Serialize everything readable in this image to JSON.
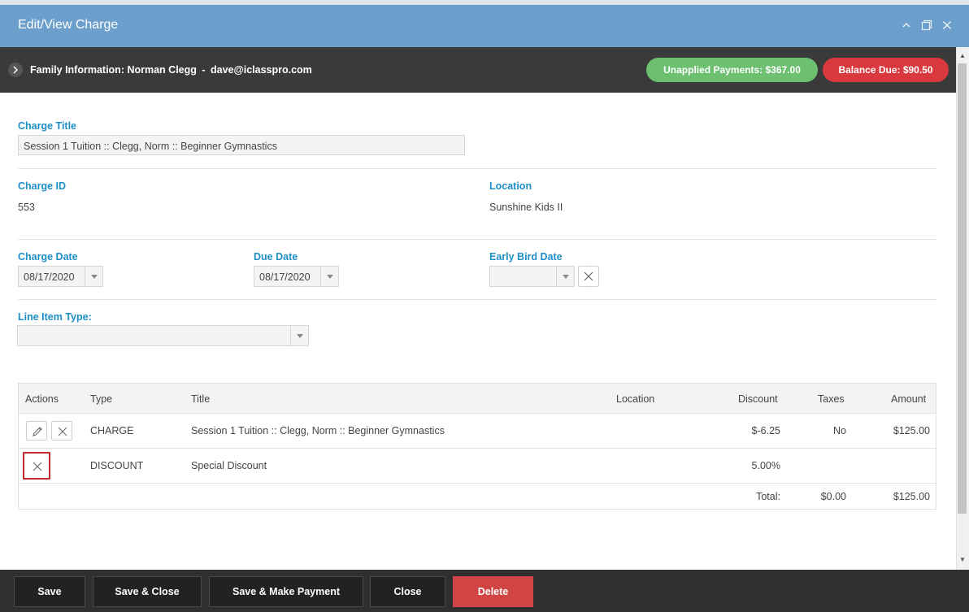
{
  "window": {
    "title": "Edit/View Charge"
  },
  "family_bar": {
    "label_prefix": "Family Information:",
    "name": "Norman Clegg",
    "separator": "-",
    "email": "dave@iclasspro.com",
    "unapplied_payments": "Unapplied Payments: $367.00",
    "balance_due": "Balance Due: $90.50"
  },
  "form": {
    "charge_title_label": "Charge Title",
    "charge_title_value": "Session 1 Tuition :: Clegg, Norm :: Beginner Gymnastics",
    "charge_id_label": "Charge ID",
    "charge_id_value": "553",
    "location_label": "Location",
    "location_value": "Sunshine Kids II",
    "charge_date_label": "Charge Date",
    "charge_date_value": "08/17/2020",
    "due_date_label": "Due Date",
    "due_date_value": "08/17/2020",
    "early_bird_label": "Early Bird Date",
    "early_bird_value": "",
    "line_item_type_label": "Line Item Type:",
    "line_item_type_value": ""
  },
  "table": {
    "headers": [
      "Actions",
      "Type",
      "Title",
      "Location",
      "Discount",
      "Taxes",
      "Amount"
    ],
    "rows": [
      {
        "type": "CHARGE",
        "title": "Session 1 Tuition :: Clegg, Norm :: Beginner Gymnastics",
        "location": "",
        "discount": "$-6.25",
        "taxes": "No",
        "amount": "$125.00"
      },
      {
        "type": "DISCOUNT",
        "title": "Special Discount",
        "location": "",
        "discount": "5.00%",
        "taxes": "",
        "amount": ""
      }
    ],
    "total_label": "Total:",
    "total_taxes": "$0.00",
    "total_amount": "$125.00"
  },
  "footer": {
    "save": "Save",
    "save_close": "Save & Close",
    "save_payment": "Save & Make Payment",
    "close": "Close",
    "delete": "Delete"
  },
  "colors": {
    "titlebar": "#6c9fcb",
    "family_bar": "#3a3a3a",
    "label_blue": "#1e8fc6",
    "unapplied_green": "#6cc070",
    "balance_red": "#d9383e",
    "delete_red": "#d14444"
  },
  "icons": {
    "collapse": "chevron-up-icon",
    "maximize": "maximize-icon",
    "close": "close-icon",
    "family_toggle": "chevron-right-icon",
    "edit": "pencil-icon",
    "remove": "x-icon"
  }
}
